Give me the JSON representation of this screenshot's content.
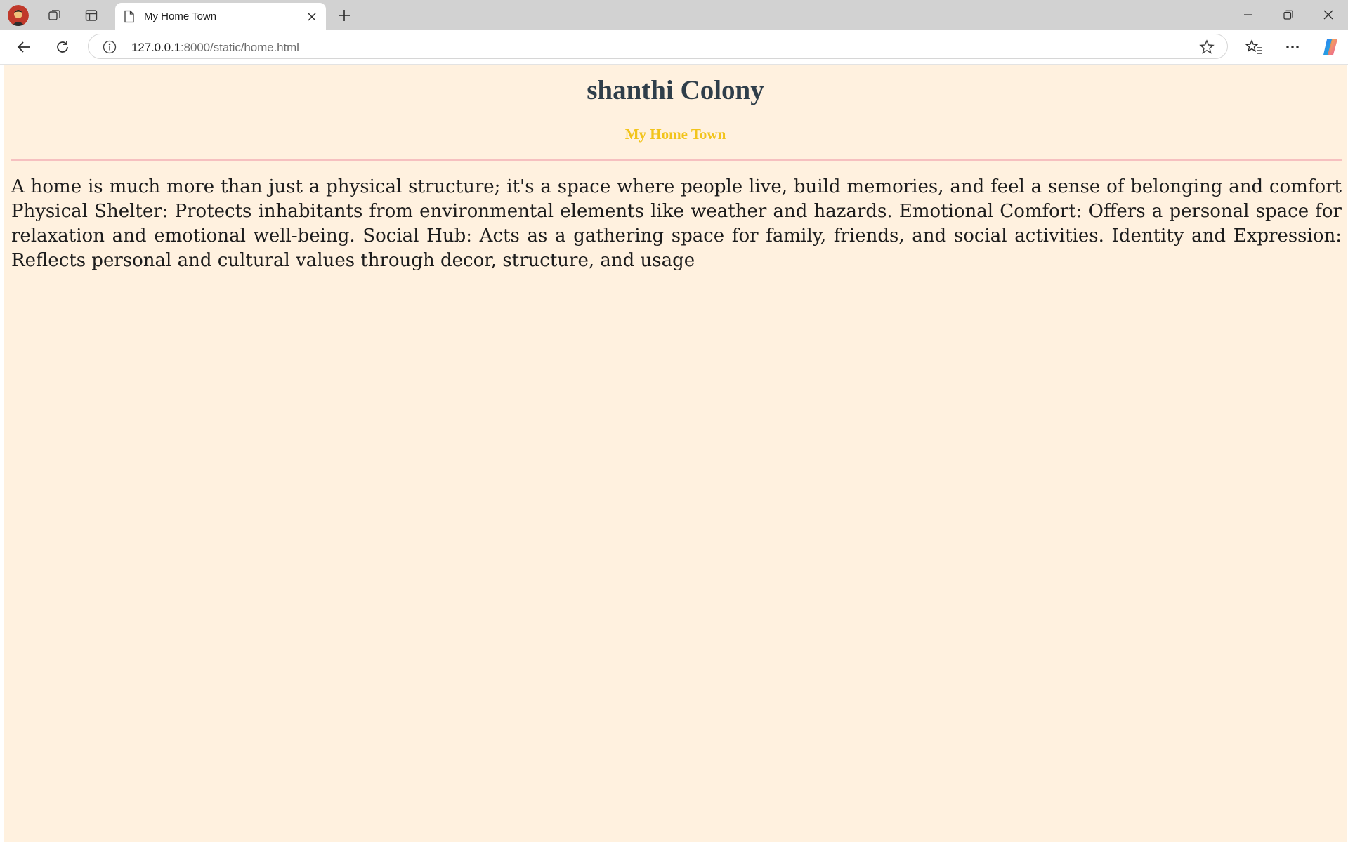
{
  "browser": {
    "tab_title": "My Home Town",
    "url_host": "127.0.0.1",
    "url_rest": ":8000/static/home.html"
  },
  "page": {
    "heading": "shanthi Colony",
    "subheading": "My Home Town",
    "paragraph": "A home is much more than just a physical structure; it's a space where people live, build memories, and feel a sense of belonging and comfort Physical Shelter: Protects inhabitants from environmental elements like weather and hazards. Emotional Comfort: Offers a personal space for relaxation and emotional well-being. Social Hub: Acts as a gathering space for family, friends, and social activities. Identity and Expression: Reflects personal and cultural values through decor, structure, and usage"
  },
  "colors": {
    "page_background": "#fff1df",
    "heading": "#2f3e4a",
    "subheading": "#f2c41b",
    "divider": "#f6c0c0"
  },
  "icons": {
    "profile": "avatar-icon",
    "workspaces": "workspaces-icon",
    "tab_actions": "vertical-tabs-icon",
    "tab_page": "document-icon",
    "tab_close": "close-icon",
    "new_tab": "plus-icon",
    "back": "back-arrow-icon",
    "reload": "reload-icon",
    "site_info": "info-icon",
    "favorite": "star-icon",
    "favorites": "favorites-icon",
    "menu": "more-icon",
    "copilot": "copilot-icon",
    "minimize": "minimize-icon",
    "restore": "restore-icon",
    "close_window": "close-window-icon"
  }
}
